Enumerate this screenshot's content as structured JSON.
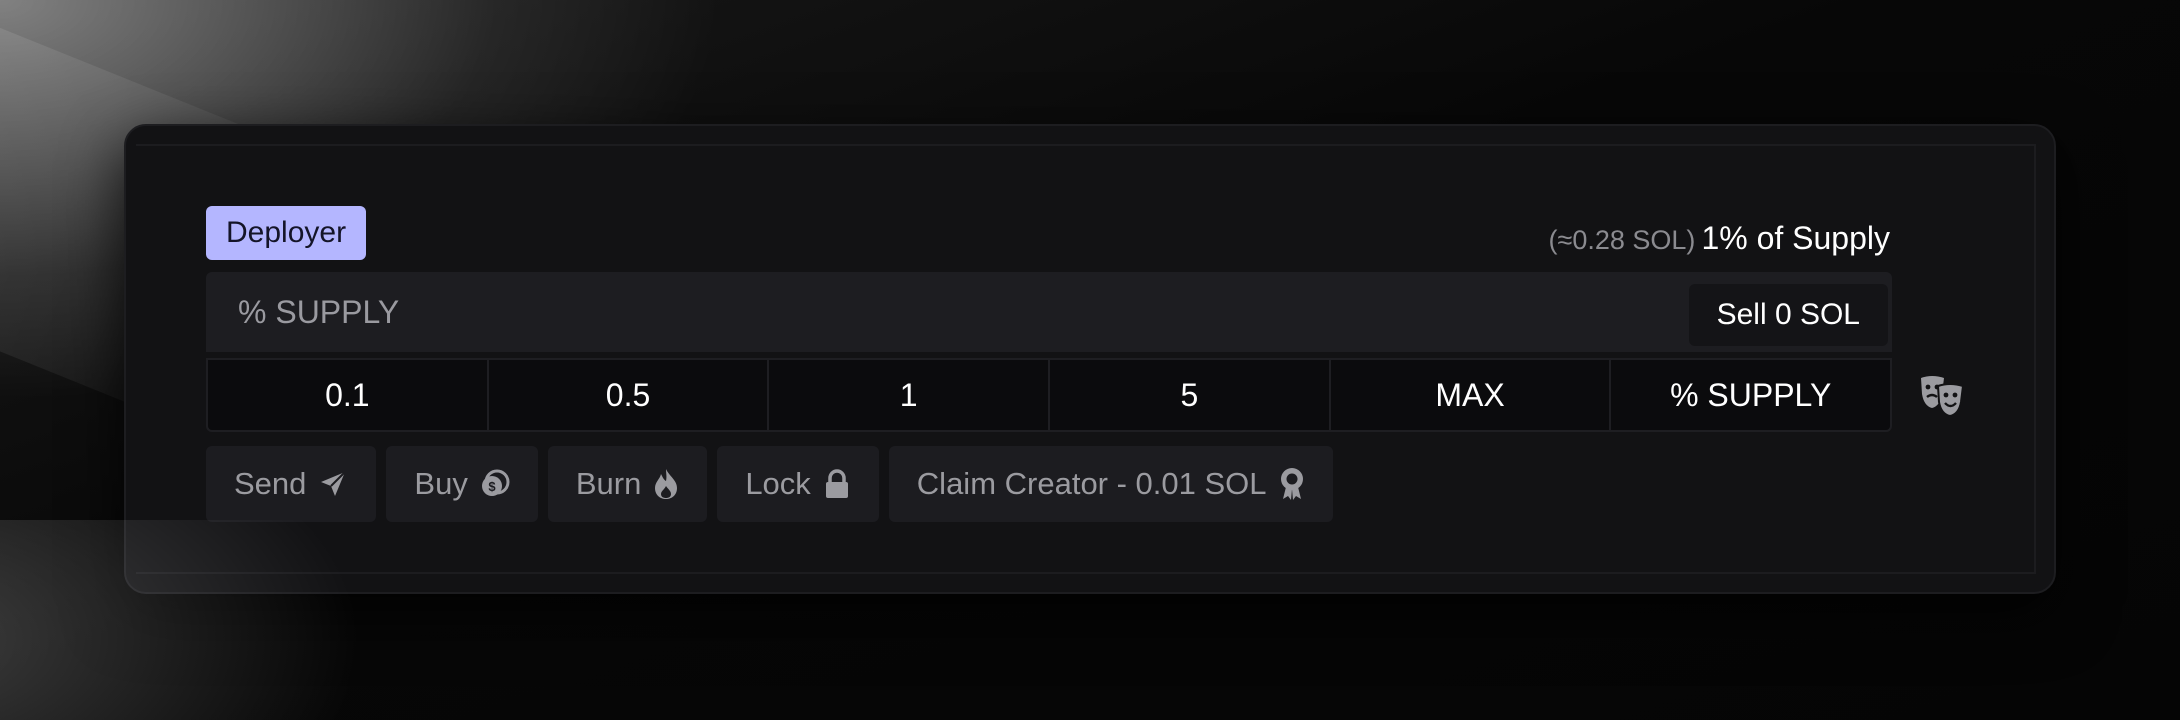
{
  "badge": {
    "label": "Deployer"
  },
  "supply_note": {
    "sol_estimate": "(≈0.28 SOL)",
    "label": "1% of Supply"
  },
  "input": {
    "placeholder": "% SUPPLY",
    "value": ""
  },
  "sell_button": {
    "label": "Sell 0 SOL"
  },
  "presets": [
    "0.1",
    "0.5",
    "1",
    "5",
    "MAX",
    "% SUPPLY"
  ],
  "mask_icon": "theater-masks-icon",
  "actions": [
    {
      "label": "Send",
      "icon": "paper-plane-icon"
    },
    {
      "label": "Buy",
      "icon": "coin-icon"
    },
    {
      "label": "Burn",
      "icon": "fire-icon"
    },
    {
      "label": "Lock",
      "icon": "lock-icon"
    },
    {
      "label": "Claim Creator - 0.01 SOL",
      "icon": "award-icon"
    }
  ],
  "colors": {
    "badge_bg": "#b4b6ff",
    "panel_bg": "#121214",
    "input_bg": "#1d1d21",
    "action_bg": "#1c1c20",
    "muted_text": "#9b9ba0"
  }
}
